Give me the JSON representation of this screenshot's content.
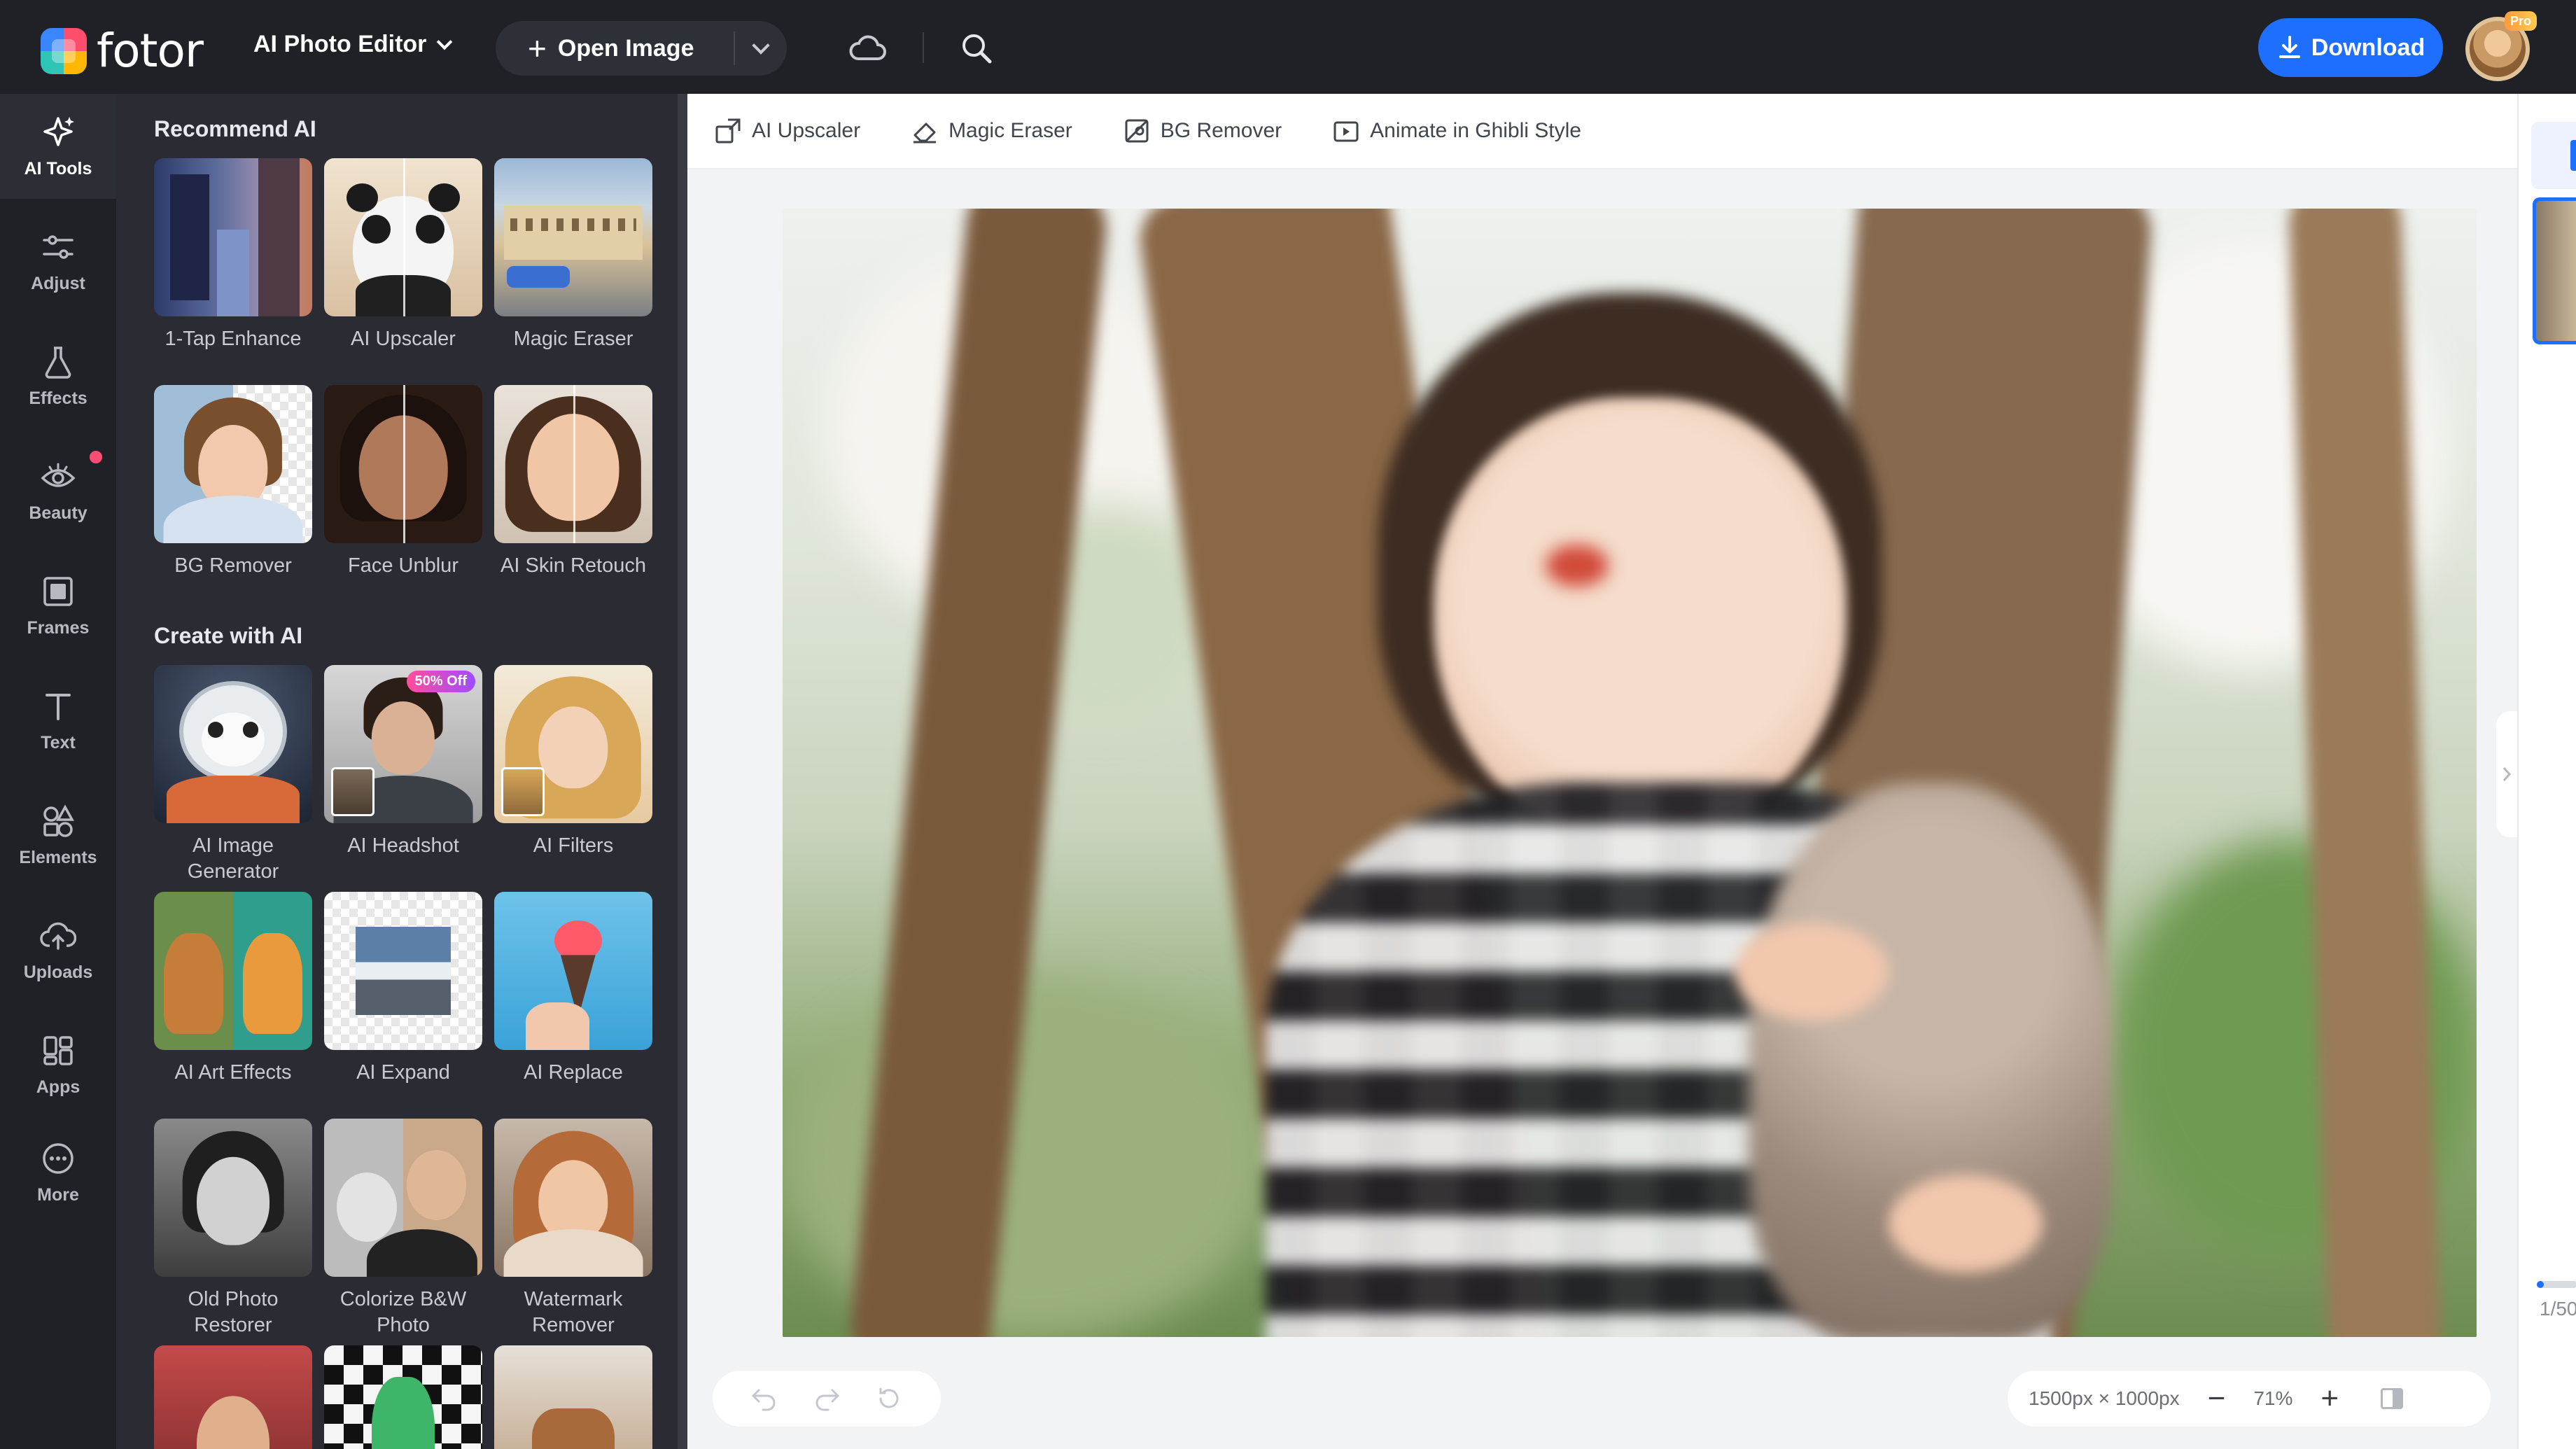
{
  "topbar": {
    "logo_text": "fotor",
    "editor_menu_label": "AI Photo Editor",
    "open_image_label": "Open Image",
    "download_label": "Download",
    "pro_badge": "Pro"
  },
  "rail": {
    "items": [
      {
        "label": "AI Tools",
        "icon": "sparkle-icon",
        "active": true
      },
      {
        "label": "Adjust",
        "icon": "sliders-icon"
      },
      {
        "label": "Effects",
        "icon": "flask-icon"
      },
      {
        "label": "Beauty",
        "icon": "eye-icon"
      },
      {
        "label": "Frames",
        "icon": "frame-icon"
      },
      {
        "label": "Text",
        "icon": "text-icon"
      },
      {
        "label": "Elements",
        "icon": "shapes-icon"
      },
      {
        "label": "Uploads",
        "icon": "upload-cloud-icon"
      },
      {
        "label": "Apps",
        "icon": "apps-icon"
      },
      {
        "label": "More",
        "icon": "more-icon"
      }
    ]
  },
  "panel": {
    "recommend_title": "Recommend AI",
    "create_title": "Create with AI",
    "recommend_tools": [
      {
        "label": "1-Tap Enhance"
      },
      {
        "label": "AI Upscaler"
      },
      {
        "label": "Magic Eraser"
      },
      {
        "label": "BG Remover"
      },
      {
        "label": "Face Unblur"
      },
      {
        "label": "AI Skin Retouch"
      }
    ],
    "create_tools": [
      {
        "label": "AI Image Generator"
      },
      {
        "label": "AI Headshot",
        "badge": "50% Off"
      },
      {
        "label": "AI Filters"
      },
      {
        "label": "AI Art Effects"
      },
      {
        "label": "AI Expand"
      },
      {
        "label": "AI Replace"
      },
      {
        "label": "Old Photo Restorer"
      },
      {
        "label": "Colorize B&W Photo"
      },
      {
        "label": "Watermark Remover"
      }
    ]
  },
  "toolbar": {
    "tools": [
      {
        "label": "AI Upscaler",
        "icon": "upscale-icon"
      },
      {
        "label": "Magic Eraser",
        "icon": "eraser-icon"
      },
      {
        "label": "BG Remover",
        "icon": "bg-remove-icon"
      },
      {
        "label": "Animate in Ghibli Style",
        "icon": "animate-icon"
      }
    ]
  },
  "canvas": {
    "dimensions": "1500px × 1000px",
    "zoom": "71%"
  },
  "strip": {
    "page_indicator": "1/50"
  },
  "colors": {
    "accent": "#1e6fff",
    "dark_bg": "#202126",
    "panel_bg": "#2b2c33",
    "canvas_bg": "#f2f3f5",
    "beauty_dot": "#ff4d73"
  }
}
